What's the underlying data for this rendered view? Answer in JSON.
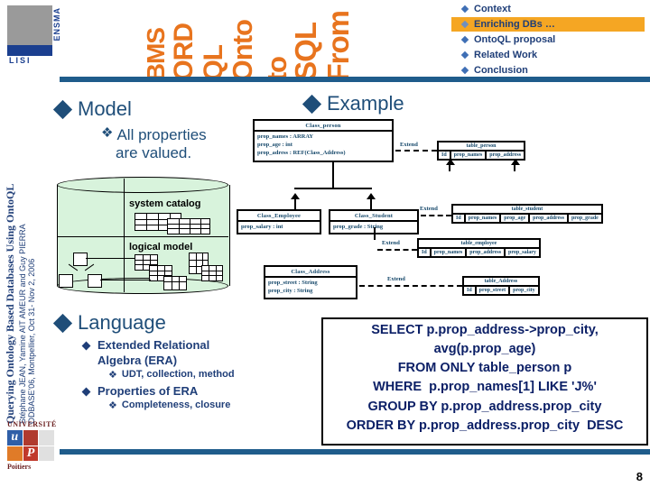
{
  "slide": {
    "page_number": "8",
    "accent_orange": "#E8741E",
    "accent_blue": "#1F4E79",
    "highlight": "#F5A623"
  },
  "logo": {
    "lisi": "LISI",
    "ensma": "ENSMA",
    "univ_top": "UNIVERSITÉ",
    "univ_letters": [
      "u",
      "",
      "",
      "",
      "P",
      ""
    ],
    "univ_bottom": "Poitiers"
  },
  "banner_words": [
    "BMS",
    "ORD",
    "QL",
    "Onto",
    "to",
    "SQL",
    "From"
  ],
  "topmenu": {
    "items": [
      {
        "label": "Context",
        "selected": false
      },
      {
        "label": "Enriching DBs …",
        "selected": true
      },
      {
        "label": "OntoQL proposal",
        "selected": false
      },
      {
        "label": "Related Work",
        "selected": false
      },
      {
        "label": "Conclusion",
        "selected": false
      }
    ]
  },
  "sidebar": {
    "title": "Querying Ontology Based Databases Using OntoQL",
    "authors": "Stéphane JEAN, Yamine AIT AMEUR and Guy PIERRA",
    "venue": "ODBASE'06, Montpellier, Oct 31- Nov 2, 2006"
  },
  "headings": {
    "model": "Model",
    "example": "Example",
    "language": "Language"
  },
  "model_bullets": [
    {
      "glyph": "❖",
      "text": "All properties"
    },
    {
      "glyph": "",
      "text": "are valued."
    }
  ],
  "cylinder": {
    "system_catalog": "system catalog",
    "logical_model": "logical model"
  },
  "language": {
    "items": [
      {
        "level": 1,
        "glyph": "◆",
        "text": "Extended Relational"
      },
      {
        "level": 1,
        "glyph": "",
        "text": "Algebra (ERA)"
      },
      {
        "level": 2,
        "glyph": "❖",
        "text": "UDT, collection, method"
      },
      {
        "level": 1,
        "glyph": "◆",
        "text": "Properties of ERA"
      },
      {
        "level": 2,
        "glyph": "❖",
        "text": "Completeness, closure"
      }
    ]
  },
  "uml": {
    "extend_label": "Extend",
    "classes": [
      {
        "name": "Class_person",
        "attributes": [
          "prop_names : ARRAY",
          "prop_age : int",
          "prop_adress : REF(Class_Address)"
        ]
      },
      {
        "name": "Class_Employee",
        "attributes": [
          "prop_salary : int"
        ]
      },
      {
        "name": "Class_Student",
        "attributes": [
          "prop_grade : String"
        ]
      },
      {
        "name": "Class_Address",
        "attributes": [
          "prop_street : String",
          "prop_city : String"
        ]
      }
    ],
    "tables": [
      {
        "name": "table_person",
        "columns": [
          "Id",
          "prop_names",
          "prop_address"
        ]
      },
      {
        "name": "table_student",
        "columns": [
          "Id",
          "prop_names",
          "prop_age",
          "prop_address",
          "prop_grade"
        ]
      },
      {
        "name": "table_employee",
        "columns": [
          "Id",
          "prop_names",
          "prop_address",
          "prop_salary"
        ]
      },
      {
        "name": "table_Address",
        "columns": [
          "Id",
          "prop_street",
          "prop_city"
        ]
      }
    ]
  },
  "sql": {
    "lines": [
      "SELECT p.prop_address->prop_city,",
      "avg(p.prop_age)",
      "FROM ONLY table_person p",
      "WHERE  p.prop_names[1] LIKE 'J%'",
      "GROUP BY p.prop_address.prop_city",
      "ORDER BY p.prop_address.prop_city  DESC"
    ]
  }
}
